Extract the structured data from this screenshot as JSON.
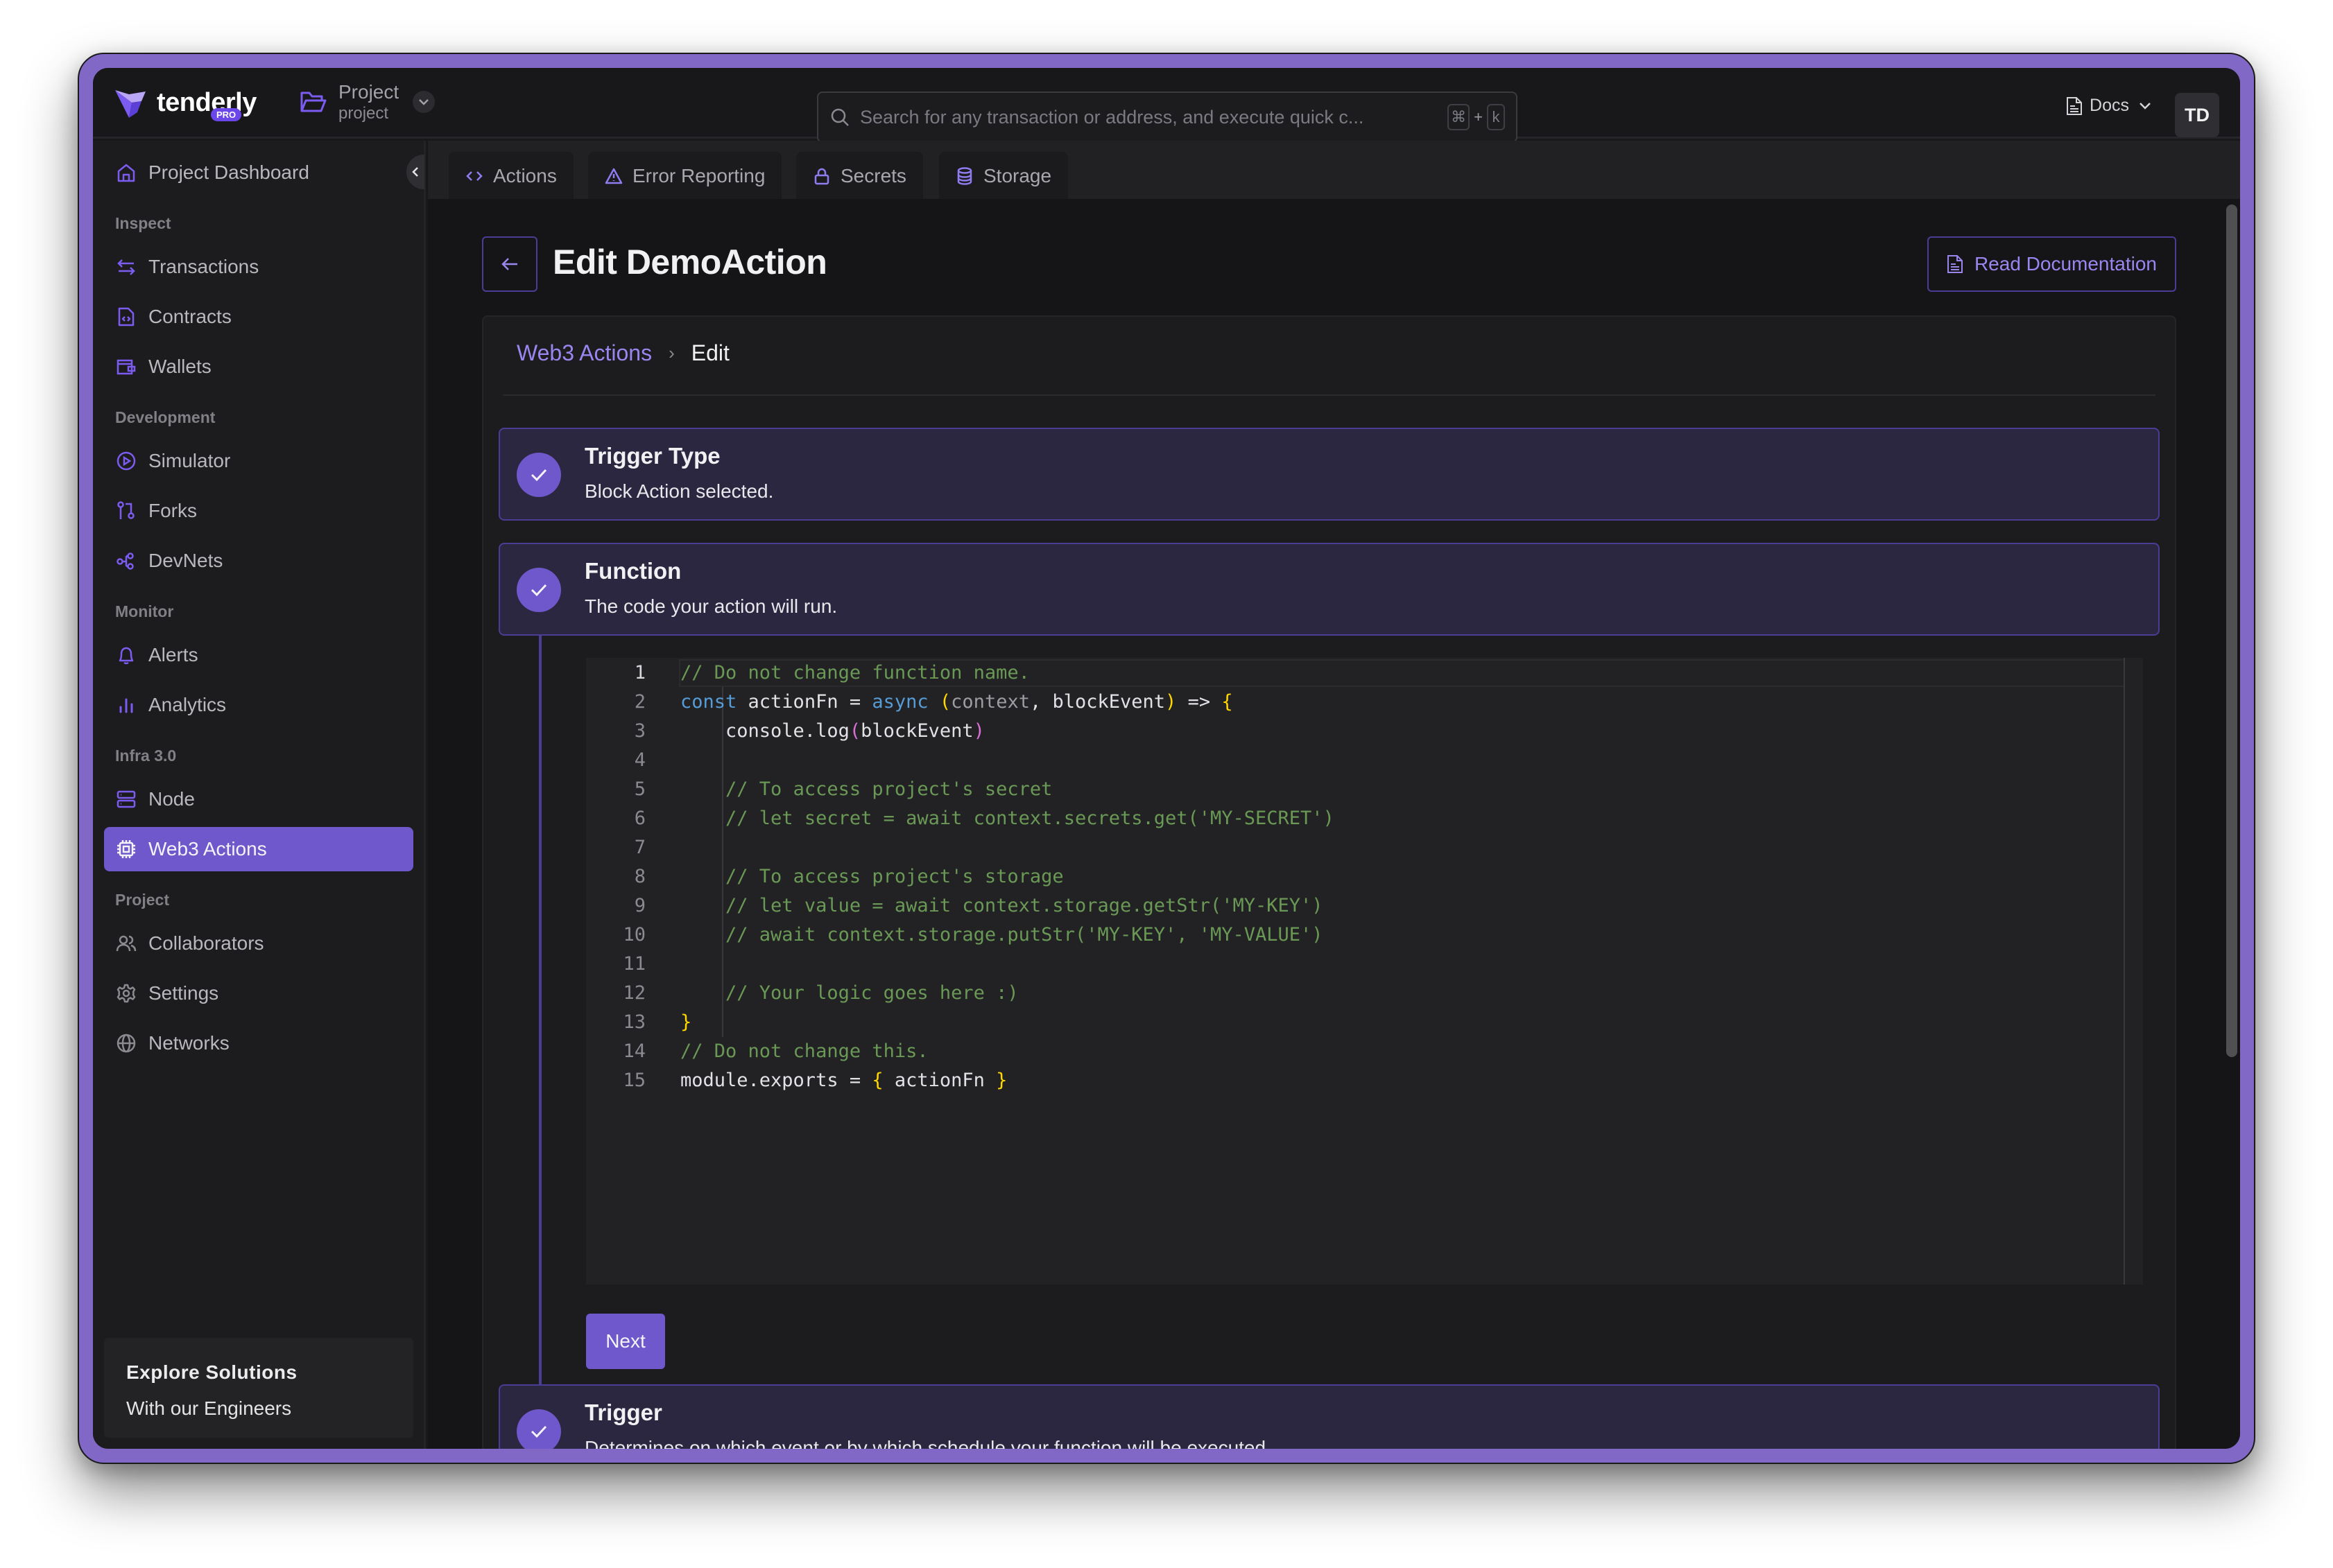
{
  "brand": {
    "name": "tenderly",
    "badge": "PRO",
    "accent": "#6e58cb"
  },
  "project": {
    "name": "Project",
    "slug": "project"
  },
  "search": {
    "placeholder": "Search for any transaction or address, and execute quick c...",
    "shortcut_key1": "⌘",
    "shortcut_plus": "+",
    "shortcut_key2": "k"
  },
  "header": {
    "docs_label": "Docs",
    "avatar_initials": "TD"
  },
  "sidebar": {
    "dashboard": "Project Dashboard",
    "sections": {
      "inspect": "Inspect",
      "development": "Development",
      "monitor": "Monitor",
      "infra": "Infra 3.0",
      "project": "Project"
    },
    "items": {
      "transactions": "Transactions",
      "contracts": "Contracts",
      "wallets": "Wallets",
      "simulator": "Simulator",
      "forks": "Forks",
      "devnets": "DevNets",
      "alerts": "Alerts",
      "analytics": "Analytics",
      "node": "Node",
      "web3_actions": "Web3 Actions",
      "collaborators": "Collaborators",
      "settings": "Settings",
      "networks": "Networks"
    },
    "active": "web3_actions",
    "explore": {
      "title": "Explore Solutions",
      "subtitle": "With our Engineers"
    }
  },
  "tabs": [
    {
      "label": "Actions",
      "icon": "code-icon"
    },
    {
      "label": "Error Reporting",
      "icon": "warning-icon"
    },
    {
      "label": "Secrets",
      "icon": "lock-icon"
    },
    {
      "label": "Storage",
      "icon": "database-icon"
    }
  ],
  "page": {
    "title": "Edit DemoAction",
    "read_docs_label": "Read Documentation",
    "breadcrumb": {
      "parent": "Web3 Actions",
      "current": "Edit"
    }
  },
  "steps": [
    {
      "title": "Trigger Type",
      "description": "Block Action selected.",
      "completed": true
    },
    {
      "title": "Function",
      "description": "The code your action will run.",
      "completed": true
    },
    {
      "title": "Trigger",
      "description": "Determines on which event or by which schedule your function will be executed.",
      "completed": true
    }
  ],
  "editor": {
    "lines": [
      "// Do not change function name.",
      "const actionFn = async (context, blockEvent) => {",
      "    console.log(blockEvent)",
      "",
      "    // To access project's secret",
      "    // let secret = await context.secrets.get('MY-SECRET')",
      "",
      "    // To access project's storage",
      "    // let value = await context.storage.getStr('MY-KEY')",
      "    // await context.storage.putStr('MY-KEY', 'MY-VALUE')",
      "",
      "    // Your logic goes here :)",
      "}",
      "// Do not change this.",
      "module.exports = { actionFn }"
    ],
    "current_line": 1
  },
  "next_label": "Next"
}
